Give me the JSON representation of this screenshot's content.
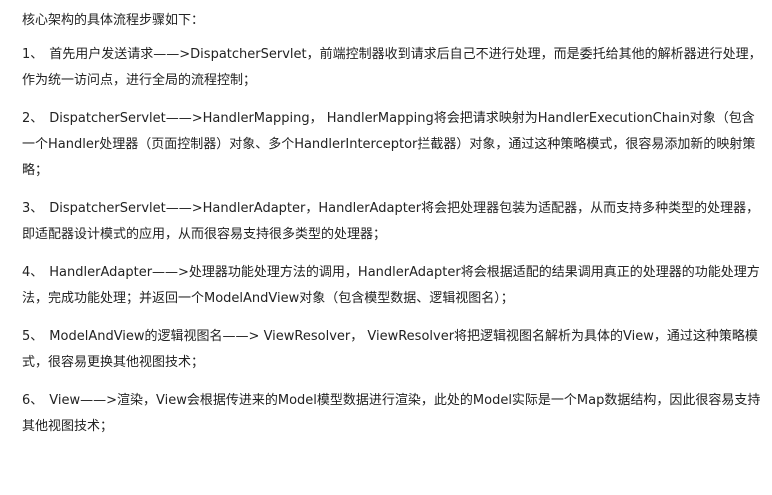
{
  "document": {
    "heading": "核心架构的具体流程步骤如下：",
    "steps": [
      {
        "number": "1、",
        "text": "首先用户发送请求——>DispatcherServlet，前端控制器收到请求后自己不进行处理，而是委托给其他的解析器进行处理，作为统一访问点，进行全局的流程控制；"
      },
      {
        "number": "2、",
        "text": "DispatcherServlet——>HandlerMapping， HandlerMapping将会把请求映射为HandlerExecutionChain对象（包含一个Handler处理器（页面控制器）对象、多个HandlerInterceptor拦截器）对象，通过这种策略模式，很容易添加新的映射策略；"
      },
      {
        "number": "3、",
        "text": "DispatcherServlet——>HandlerAdapter，HandlerAdapter将会把处理器包装为适配器，从而支持多种类型的处理器，即适配器设计模式的应用，从而很容易支持很多类型的处理器；"
      },
      {
        "number": "4、",
        "text": "HandlerAdapter——>处理器功能处理方法的调用，HandlerAdapter将会根据适配的结果调用真正的处理器的功能处理方法，完成功能处理；并返回一个ModelAndView对象（包含模型数据、逻辑视图名）；"
      },
      {
        "number": "5、",
        "text": "ModelAndView的逻辑视图名——> ViewResolver， ViewResolver将把逻辑视图名解析为具体的View，通过这种策略模式，很容易更换其他视图技术；"
      },
      {
        "number": "6、",
        "text": "View——>渲染，View会根据传进来的Model模型数据进行渲染，此处的Model实际是一个Map数据结构，因此很容易支持其他视图技术；"
      }
    ]
  }
}
